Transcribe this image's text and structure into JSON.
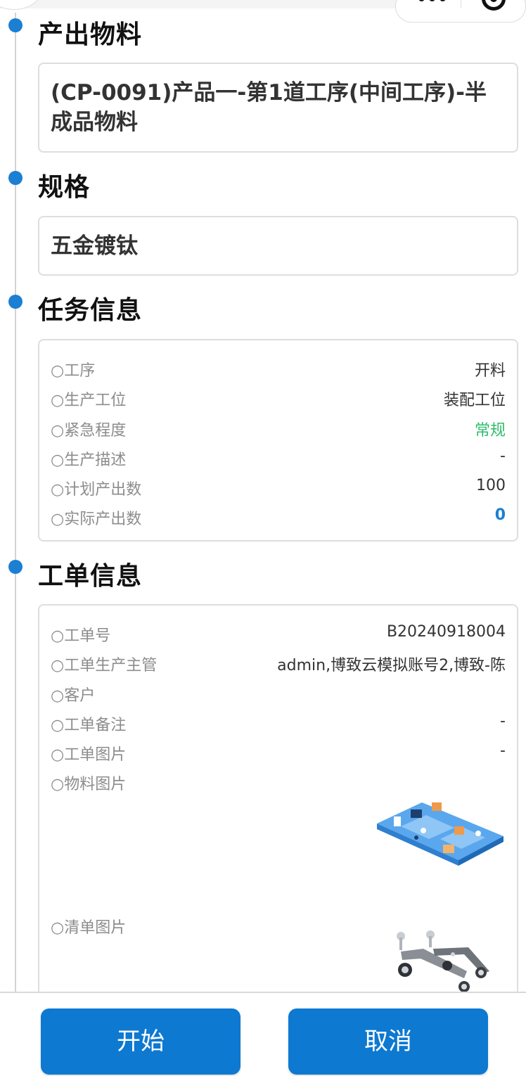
{
  "sections": {
    "output_material": {
      "title": "产出物料",
      "value": "(CP-0091)产品一-第1道工序(中间工序)-半成品物料"
    },
    "spec": {
      "title": "规格",
      "value": "五金镀钛"
    },
    "task_info": {
      "title": "任务信息",
      "rows": [
        {
          "key": "○工序",
          "value": "开料"
        },
        {
          "key": "○生产工位",
          "value": "装配工位"
        },
        {
          "key": "○紧急程度",
          "value": "常规"
        },
        {
          "key": "○生产描述",
          "value": "-"
        },
        {
          "key": "○计划产出数",
          "value": "100"
        },
        {
          "key": "○实际产出数",
          "value": "0"
        }
      ]
    },
    "order_info": {
      "title": "工单信息",
      "rows": [
        {
          "key": "○工单号",
          "value": "B20240918004"
        },
        {
          "key": "○工单生产主管",
          "value": "admin,博致云模拟账号2,博致-陈"
        },
        {
          "key": "○客户",
          "value": ""
        },
        {
          "key": "○工单备注",
          "value": "-"
        },
        {
          "key": "○工单图片",
          "value": "-"
        },
        {
          "key": "○物料图片",
          "value": ""
        },
        {
          "key": "○清单图片",
          "value": ""
        }
      ]
    }
  },
  "buttons": {
    "start": "开始",
    "cancel": "取消"
  },
  "colors": {
    "accent": "#1b7fd3",
    "button": "#0d79d1",
    "urgency_normal": "#2ebc6b"
  },
  "icons": {
    "more": "more-dots-icon",
    "close": "capsule-target-icon"
  }
}
